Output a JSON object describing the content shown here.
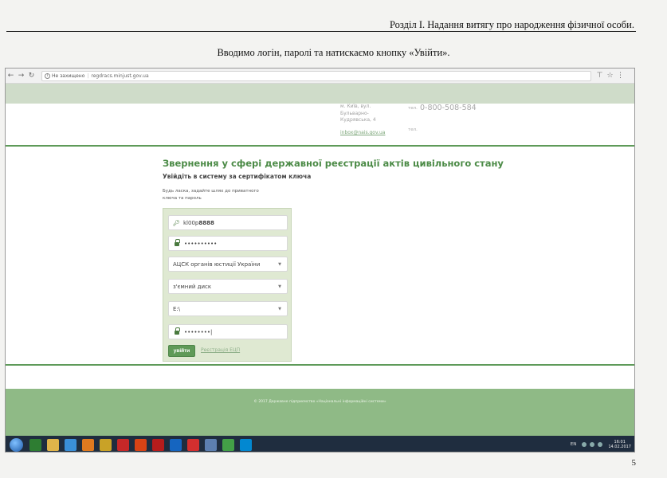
{
  "document": {
    "header": "Розділ I. Надання витягу про народження фізичної особи.",
    "instruction": "Вводимо логін, паролі та натискаємо кнопку «Увійти».",
    "page_number": "5"
  },
  "browser": {
    "security_label": "Не захищено",
    "url": "regdracs.minjust.gov.ua"
  },
  "site_header": {
    "address_lines": [
      "м. Київ, вул.",
      "Бульварно-",
      "Кудрявська, 4"
    ],
    "tel_label": "тел.",
    "tel_number": "0-800-508-584",
    "email": "inbox@nais.gov.ua",
    "fax_label": "тел."
  },
  "main": {
    "title": "Звернення у сфері державної реєстрації актів цивільного стану",
    "subtitle": "Увійдіть в систему за сертифікатом ключа",
    "hint": "Будь ласка, задайте шлях до приватного ключа та пароль"
  },
  "login_form": {
    "login_prefix": "kl00p",
    "login_suffix": "8888",
    "password_mask": "••••••••••",
    "certificate_center": "АЦСК органів юстиції України",
    "media_type": "з'ємний диск",
    "drive_path": "E:\\",
    "key_password_mask": "••••••••|",
    "login_button": "увійти",
    "register_link": "Реєстрація ЕЦП"
  },
  "footer": {
    "text": "© 2017 Державне підприємство «Національні інформаційні системи»"
  },
  "taskbar": {
    "language": "EN",
    "time": "16:01",
    "date": "14.02.2017",
    "icons": [
      {
        "name": "excel-icon",
        "color": "#2e7d32"
      },
      {
        "name": "folder-icon",
        "color": "#e0b44a"
      },
      {
        "name": "internet-explorer-icon",
        "color": "#3a8fd8"
      },
      {
        "name": "media-player-icon",
        "color": "#e07a1f"
      },
      {
        "name": "puzzle-icon",
        "color": "#c9a227"
      },
      {
        "name": "acrobat-icon",
        "color": "#c62828"
      },
      {
        "name": "compass-icon",
        "color": "#d84315"
      },
      {
        "name": "filezilla-icon",
        "color": "#b71c1c"
      },
      {
        "name": "photoshop-icon",
        "color": "#1565c0"
      },
      {
        "name": "opera-icon",
        "color": "#d32f2f"
      },
      {
        "name": "window-icon",
        "color": "#5d7fb0"
      },
      {
        "name": "chrome-icon",
        "color": "#43a047"
      },
      {
        "name": "skype-icon",
        "color": "#0288d1"
      }
    ]
  }
}
